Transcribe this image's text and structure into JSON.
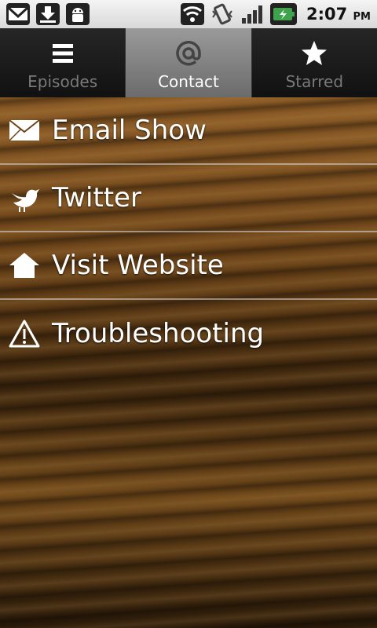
{
  "status_bar": {
    "icons": [
      "gmail-icon",
      "download-icon",
      "android-debug-icon",
      "wifi-icon",
      "vibrate-icon",
      "signal-icon",
      "battery-icon"
    ],
    "time": "2:07",
    "ampm": "PM"
  },
  "tabs": [
    {
      "label": "Episodes",
      "icon": "list-icon",
      "active": false
    },
    {
      "label": "Contact",
      "icon": "at-icon",
      "active": true
    },
    {
      "label": "Starred",
      "icon": "star-icon",
      "active": false
    }
  ],
  "menu": [
    {
      "label": "Email Show",
      "icon": "envelope-icon"
    },
    {
      "label": "Twitter",
      "icon": "bird-icon"
    },
    {
      "label": "Visit Website",
      "icon": "home-icon"
    },
    {
      "label": "Troubleshooting",
      "icon": "warning-icon"
    }
  ],
  "colors": {
    "active_tab": "#8a8a8a",
    "inactive_label": "#7a7a7a"
  }
}
